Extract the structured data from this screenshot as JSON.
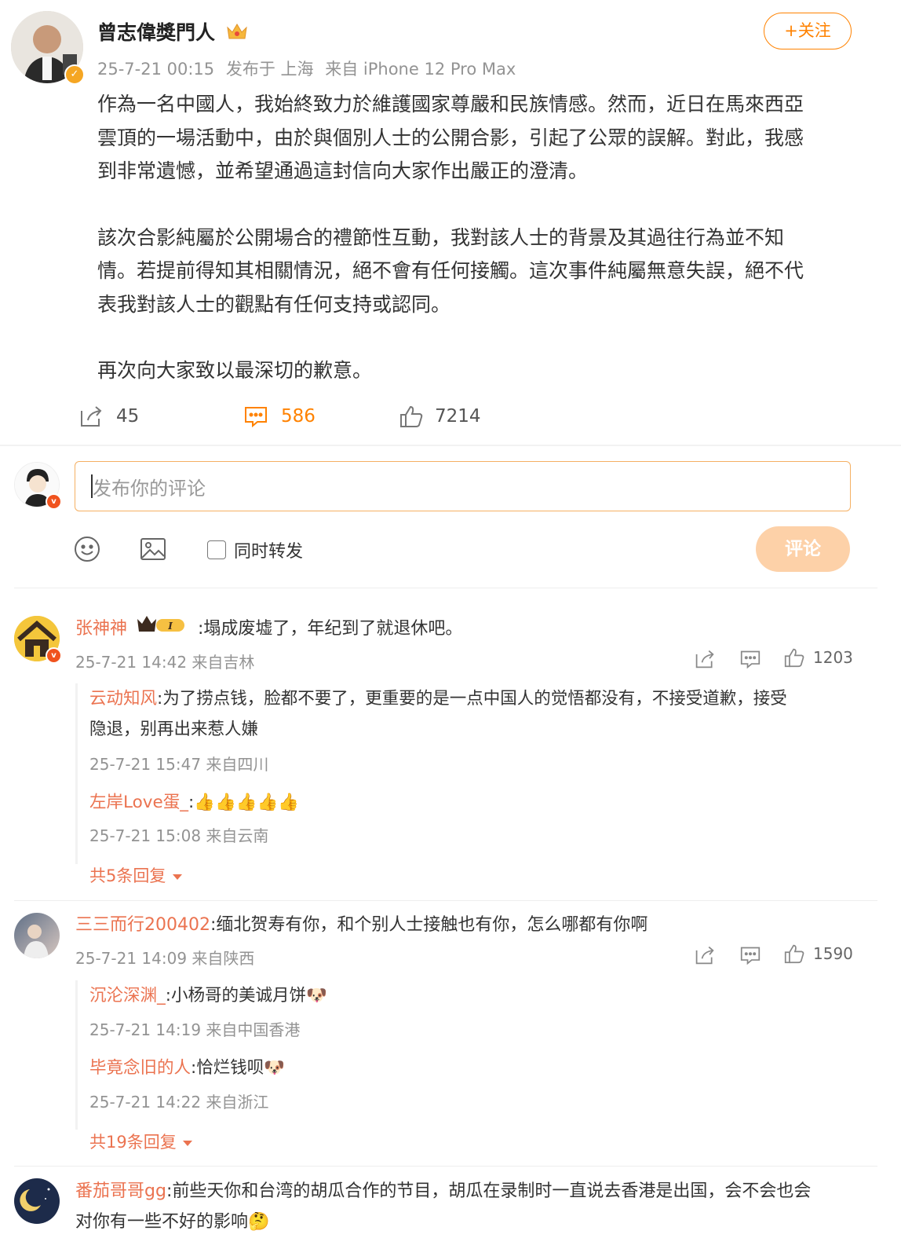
{
  "post": {
    "author": "曾志偉獎門人",
    "meta_time": "25-7-21 00:15",
    "meta_publish": "发布于 上海",
    "meta_device": "来自 iPhone 12 Pro Max",
    "follow_label": "+关注",
    "paragraphs": [
      "作為一名中國人，我始終致力於維護國家尊嚴和民族情感。然而，近日在馬來西亞\n雲頂的一場活動中，由於與個別人士的公開合影，引起了公眾的誤解。對此，我感\n到非常遺憾，並希望通過這封信向大家作出嚴正的澄清。",
      "該次合影純屬於公開場合的禮節性互動，我對該人士的背景及其過往行為並不知\n情。若提前得知其相關情況，絕不會有任何接觸。這次事件純屬無意失誤，絕不代\n表我對該人士的觀點有任何支持或認同。",
      "再次向大家致以最深切的歉意。"
    ],
    "repost_count": "45",
    "comment_count": "586",
    "like_count": "7214"
  },
  "compose": {
    "placeholder": "发布你的评论",
    "repost_label": "同时转发",
    "submit_label": "评论"
  },
  "comments": [
    {
      "name": "张神神",
      "text": ":塌成废墟了，年纪到了就退休吧。",
      "time": "25-7-21 14:42 来自吉林",
      "likes": "1203",
      "replies": [
        {
          "name": "云动知风",
          "text": ":为了捞点钱，脸都不要了，更重要的是一点中国人的觉悟都没有，不接受道歉，接受",
          "text2": "隐退，别再出来惹人嫌",
          "time": "25-7-21 15:47 来自四川"
        },
        {
          "name": "左岸Love蛋_",
          "text": ":👍👍👍👍👍",
          "time": "25-7-21 15:08 来自云南"
        }
      ],
      "more": "共5条回复"
    },
    {
      "name": "三三而行200402",
      "text": ":缅北贺寿有你，和个别人士接触也有你，怎么哪都有你啊",
      "time": "25-7-21 14:09 来自陕西",
      "likes": "1590",
      "replies": [
        {
          "name": "沉沦深渊_",
          "text": ":小杨哥的美诚月饼🐶",
          "time": "25-7-21 14:19 来自中国香港"
        },
        {
          "name": "毕竟念旧的人",
          "text": ":恰烂钱呗🐶",
          "time": "25-7-21 14:22 来自浙江"
        }
      ],
      "more": "共19条回复"
    },
    {
      "name": "番茄哥哥gg",
      "text": ":前些天你和台湾的胡瓜合作的节目，胡瓜在录制时一直说去香港是出国，会不会也会",
      "text2": "对你有一些不好的影响🤔"
    }
  ],
  "colors": {
    "accent": "#ff8200",
    "name": "#eb7350",
    "meta": "#939393"
  }
}
